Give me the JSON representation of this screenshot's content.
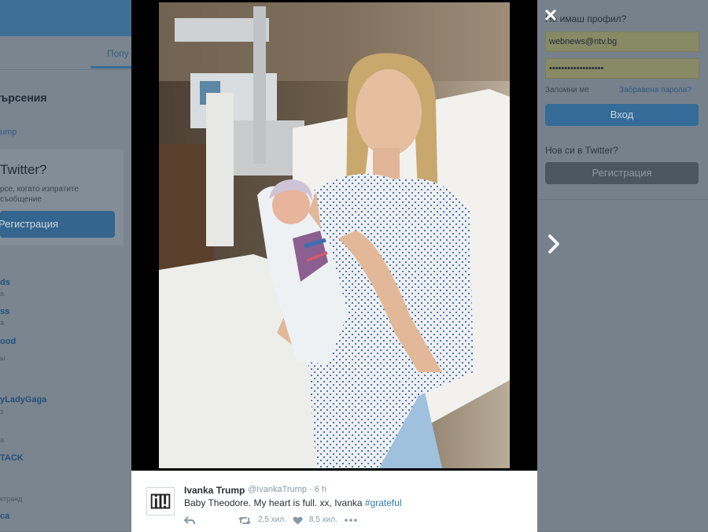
{
  "left_panel": {
    "tab_label": "Попу",
    "section_title": "ърсения",
    "small_link": "ump",
    "join": {
      "title": "Twitter?",
      "description": "рсе, когато изпратите\nсъобщение",
      "button": "Регистрация"
    },
    "trends": [
      {
        "name": "ds",
        "sub": "а"
      },
      {
        "name": "ss",
        "sub": "а"
      },
      {
        "name": "ood",
        "sub": "ы"
      },
      {
        "name": "yLadyGaga",
        "sub": "з"
      },
      {
        "name": "TACK",
        "sub": "а"
      },
      {
        "name": "ca",
        "sub": "ктранд"
      }
    ]
  },
  "right_panel": {
    "login_title": "Не имаш профил?",
    "username_value": "webnews@ntv.bg",
    "password_value": "••••••••••••••••••",
    "remember_label": "Запомни ме",
    "forgot_link": "Забравена парола?",
    "login_button": "Вход",
    "new_question": "Нов си в Twitter?",
    "register_button": "Регистрация"
  },
  "lightbox": {
    "close_icon": "close-icon",
    "next_icon": "chevron-right-icon"
  },
  "tweet": {
    "author_name": "Ivanka Trump",
    "handle": "@IvankaTrump",
    "separator": "·",
    "time": "6 h",
    "text": "Baby Theodore. My heart is full. xx, Ivanka",
    "hashtag": "#grateful",
    "reply_icon": "reply-icon",
    "retweet_icon": "retweet-icon",
    "retweet_count": "2,5 хил.",
    "like_icon": "heart-icon",
    "like_count": "8,5 хил.",
    "more_icon": "more-icon"
  }
}
